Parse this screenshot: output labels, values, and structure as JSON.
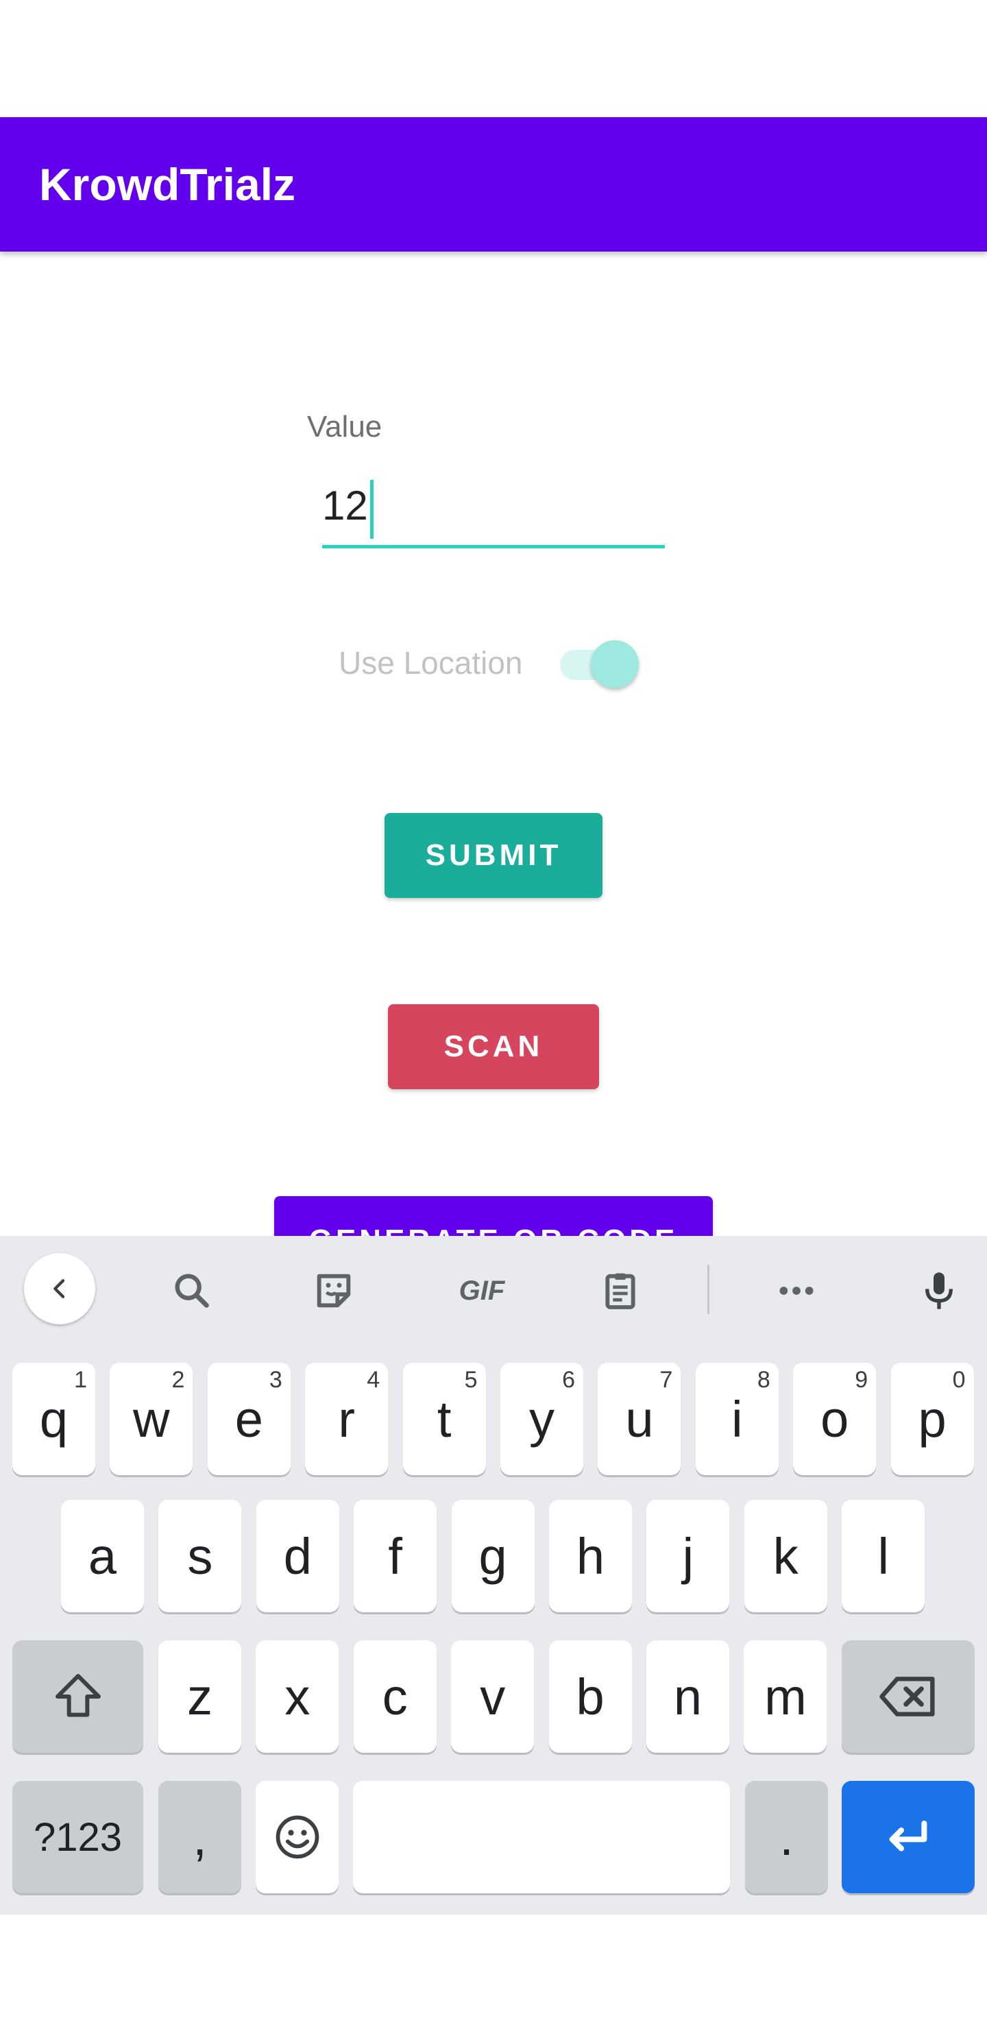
{
  "app": {
    "title": "KrowdTrialz"
  },
  "form": {
    "value_label": "Value",
    "value": "12",
    "location_label": "Use Location",
    "location_enabled": true,
    "submit_label": "SUBMIT",
    "scan_label": "SCAN",
    "qr_label": "GENERATE QR CODE"
  },
  "keyboard": {
    "toolbar": {
      "gif_label": "GIF",
      "icons": [
        "chevron-left-icon",
        "search-icon",
        "sticker-icon",
        "gif-icon",
        "clipboard-icon",
        "more-icon",
        "microphone-icon"
      ]
    },
    "row1": [
      {
        "k": "q",
        "h": "1"
      },
      {
        "k": "w",
        "h": "2"
      },
      {
        "k": "e",
        "h": "3"
      },
      {
        "k": "r",
        "h": "4"
      },
      {
        "k": "t",
        "h": "5"
      },
      {
        "k": "y",
        "h": "6"
      },
      {
        "k": "u",
        "h": "7"
      },
      {
        "k": "i",
        "h": "8"
      },
      {
        "k": "o",
        "h": "9"
      },
      {
        "k": "p",
        "h": "0"
      }
    ],
    "row2": [
      "a",
      "s",
      "d",
      "f",
      "g",
      "h",
      "j",
      "k",
      "l"
    ],
    "row3": [
      "z",
      "x",
      "c",
      "v",
      "b",
      "n",
      "m"
    ],
    "symbols_label": "?123",
    "comma_label": ",",
    "period_label": ".",
    "accent_color": "#1a73e8"
  },
  "colors": {
    "primary": "#6200EE",
    "accent": "#2ad1bf",
    "submit": "#1aad9a",
    "scan": "#d5455d"
  }
}
